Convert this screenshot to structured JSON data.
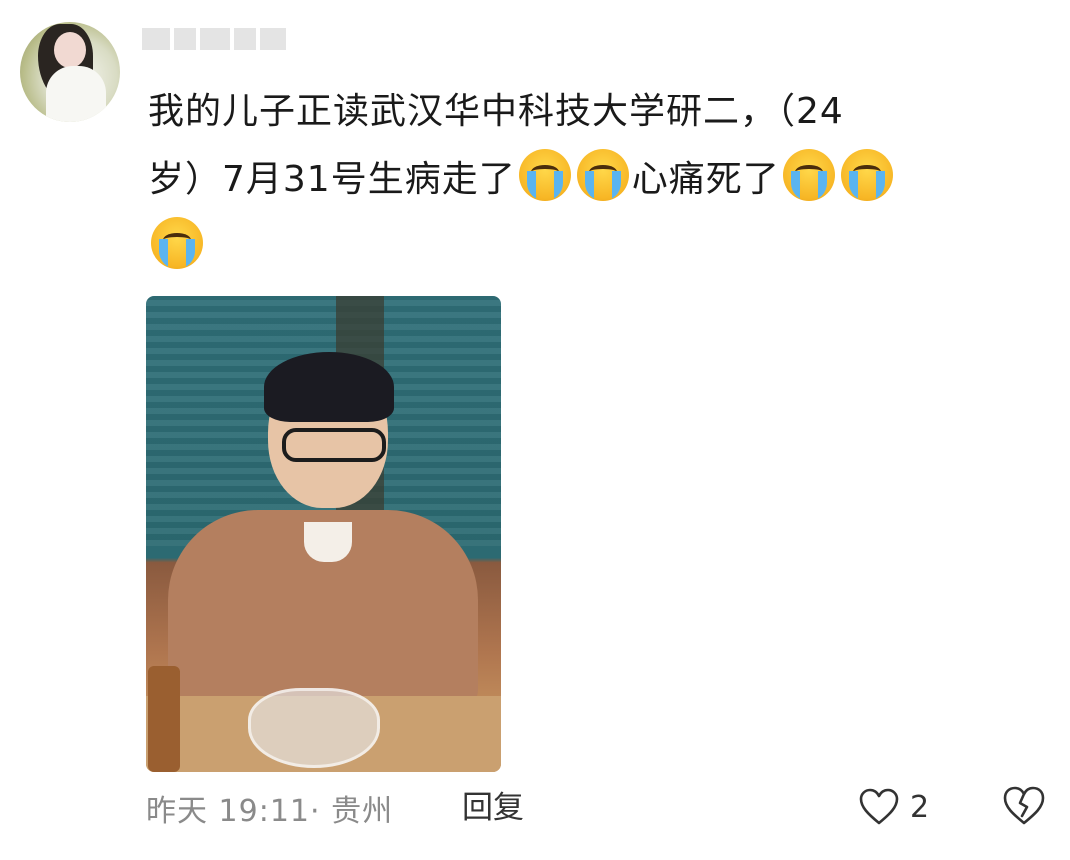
{
  "comment": {
    "line1": "我的儿子正读武汉华中科技大学研二，（24",
    "line2_prefix": "岁）7月31号生病走了",
    "line2_mid": "心痛死了",
    "emoji_name": "loudly-crying-face-icon"
  },
  "footer": {
    "meta": "昨天 19:11· 贵州",
    "reply": "回复",
    "like_count": "2"
  },
  "colors": {
    "meta_gray": "#8a8a8a",
    "text": "#1a1a1a"
  }
}
